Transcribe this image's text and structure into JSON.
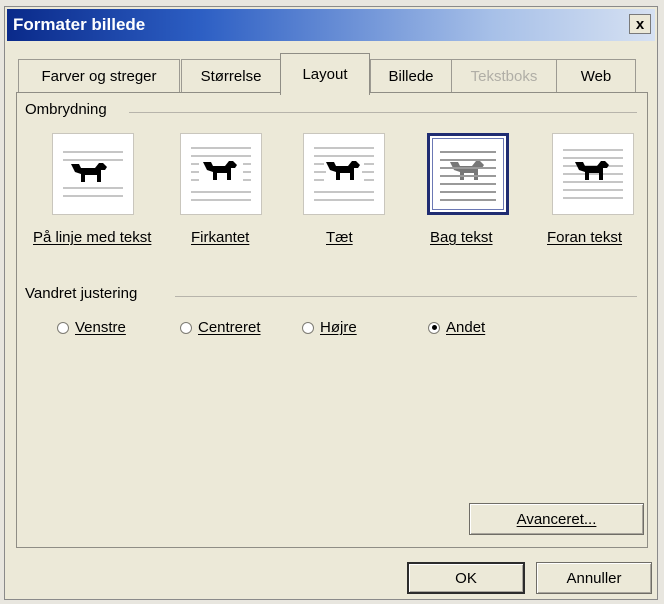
{
  "dialog": {
    "title": "Formater billede",
    "close_label": "x"
  },
  "tabs": [
    {
      "label": "Farver og streger",
      "active": false,
      "disabled": false
    },
    {
      "label": "Størrelse",
      "active": false,
      "disabled": false
    },
    {
      "label": "Layout",
      "active": true,
      "disabled": false
    },
    {
      "label": "Billede",
      "active": false,
      "disabled": false
    },
    {
      "label": "Tekstboks",
      "active": false,
      "disabled": true
    },
    {
      "label": "Web",
      "active": false,
      "disabled": false
    }
  ],
  "wrapping": {
    "group_label": "Ombrydning",
    "options": [
      {
        "label": "På linje med tekst",
        "selected": false,
        "icon": "inline-with-text-icon"
      },
      {
        "label": "Firkantet",
        "selected": false,
        "icon": "square-wrap-icon"
      },
      {
        "label": "Tæt",
        "selected": false,
        "icon": "tight-wrap-icon"
      },
      {
        "label": "Bag tekst",
        "selected": true,
        "icon": "behind-text-icon"
      },
      {
        "label": "Foran tekst",
        "selected": false,
        "icon": "in-front-of-text-icon"
      }
    ]
  },
  "alignment": {
    "group_label": "Vandret justering",
    "options": [
      {
        "label": "Venstre",
        "checked": false
      },
      {
        "label": "Centreret",
        "checked": false
      },
      {
        "label": "Højre",
        "checked": false
      },
      {
        "label": "Andet",
        "checked": true
      }
    ]
  },
  "buttons": {
    "advanced": "Avanceret...",
    "ok": "OK",
    "cancel": "Annuller"
  },
  "colors": {
    "title_bar_start": "#0a2a8a",
    "dialog_background": "#ece9d8",
    "selected_border": "#1f2c72"
  }
}
